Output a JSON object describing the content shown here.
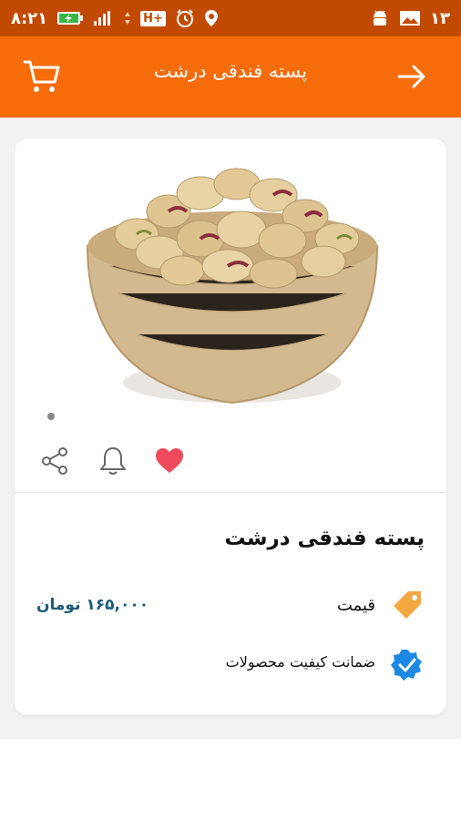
{
  "status_bar": {
    "time": "۸:۲۱",
    "battery_label": "⚡",
    "network_label": "H+",
    "notification_count": "۱۳"
  },
  "header": {
    "title": "پسته فندقی درشت",
    "cart_icon": "cart-icon",
    "back_icon": "arrow-right-icon"
  },
  "product": {
    "name": "پسته فندقی درشت",
    "price_label": "قیمت",
    "price_value": "۱۶۵,۰۰۰ تومان",
    "guarantee": "ضمانت کیفیت محصولات",
    "actions": {
      "favorite_icon": "heart-icon",
      "notify_icon": "bell-icon",
      "share_icon": "share-icon"
    }
  },
  "colors": {
    "header": "#f66c0b",
    "status_bar": "#c24a00",
    "price": "#1d5a78",
    "heart": "#ef4a5c",
    "tag": "#f5a742",
    "verified": "#1e88e5"
  }
}
